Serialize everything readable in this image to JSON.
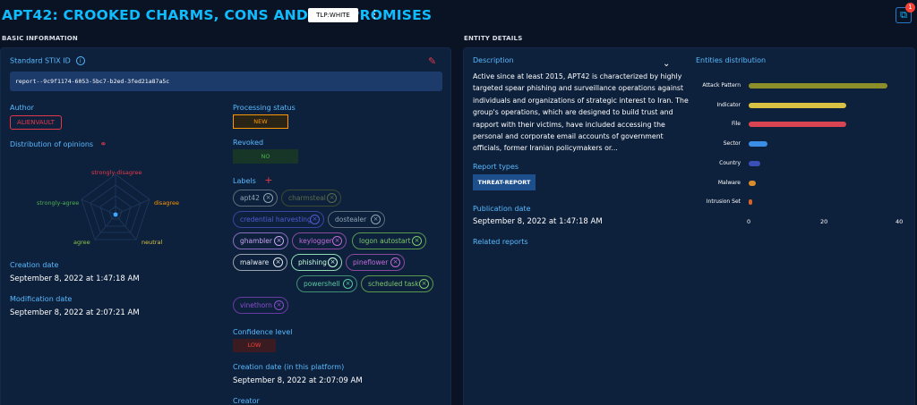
{
  "header": {
    "title": "APT42: CROOKED CHARMS, CONS AND COMPROMISES",
    "tlp": "TLP:WHITE",
    "notification_count": "1"
  },
  "basic": {
    "section_title": "BASIC INFORMATION",
    "stix_label": "Standard STIX ID",
    "stix_id": "report--9c9f1174-6053-5bc7-b2ed-3fed21a87a5c",
    "author_label": "Author",
    "author": "ALIENVAULT",
    "opinions_label": "Distribution of opinions",
    "radar_labels": {
      "strongly_disagree": "strongly-disagree",
      "disagree": "disagree",
      "neutral": "neutral",
      "agree": "agree",
      "strongly_agree": "strongly-agree"
    },
    "creation_label": "Creation date",
    "creation_value": "September 8, 2022 at 1:47:18 AM",
    "modification_label": "Modification date",
    "modification_value": "September 8, 2022 at 2:07:21 AM",
    "processing_label": "Processing status",
    "processing_value": "NEW",
    "revoked_label": "Revoked",
    "revoked_value": "NO",
    "labels_label": "Labels",
    "labels": [
      {
        "text": "apt42",
        "color": "#8fa6b3"
      },
      {
        "text": "charmsteal",
        "color": "#5b6b4a"
      },
      {
        "text": "credential harvesting",
        "color": "#4f5bd5"
      },
      {
        "text": "dostealer",
        "color": "#8fa6b3"
      },
      {
        "text": "ghambler",
        "color": "#c9a4f3"
      },
      {
        "text": "keylogger",
        "color": "#c06bd8"
      },
      {
        "text": "logon autostart",
        "color": "#7ec86d"
      },
      {
        "text": "malware",
        "color": "#e3e8ef"
      },
      {
        "text": "phishing",
        "color": "#c8ffe0"
      },
      {
        "text": "pineflower",
        "color": "#c06bd8"
      },
      {
        "text": "powershell",
        "color": "#59c8a0"
      },
      {
        "text": "scheduled task",
        "color": "#7ec86d"
      },
      {
        "text": "vinethorn",
        "color": "#8a4fd0"
      }
    ],
    "confidence_label": "Confidence level",
    "confidence_value": "LOW",
    "platform_creation_label": "Creation date (in this platform)",
    "platform_creation_value": "September 8, 2022 at 2:07:09 AM",
    "creator_label": "Creator"
  },
  "entity": {
    "section_title": "ENTITY DETAILS",
    "description_label": "Description",
    "description": "Active since at least 2015, APT42 is characterized by highly targeted spear phishing and surveillance operations against individuals and organizations of strategic interest to Iran. The group's operations, which are designed to build trust and rapport with their victims, have included accessing the personal and corporate email accounts of government officials, former Iranian policymakers or...",
    "report_types_label": "Report types",
    "report_type": "THREAT-REPORT",
    "publication_label": "Publication date",
    "publication_value": "September 8, 2022 at 1:47:18 AM",
    "related_label": "Related reports",
    "distribution_label": "Entities distribution"
  },
  "chart_data": {
    "type": "bar",
    "orientation": "horizontal",
    "categories": [
      "Attack Pattern",
      "Indicator",
      "File",
      "Sector",
      "Country",
      "Malware",
      "Intrusion Set"
    ],
    "values": [
      37,
      26,
      26,
      5,
      3,
      2,
      1
    ],
    "colors": [
      "#8c8e2a",
      "#d9c143",
      "#d94452",
      "#3a8ee6",
      "#3a4fb8",
      "#d98c2a",
      "#d9622a"
    ],
    "xticks": [
      "0",
      "20",
      "40"
    ],
    "xlim": [
      0,
      40
    ]
  }
}
